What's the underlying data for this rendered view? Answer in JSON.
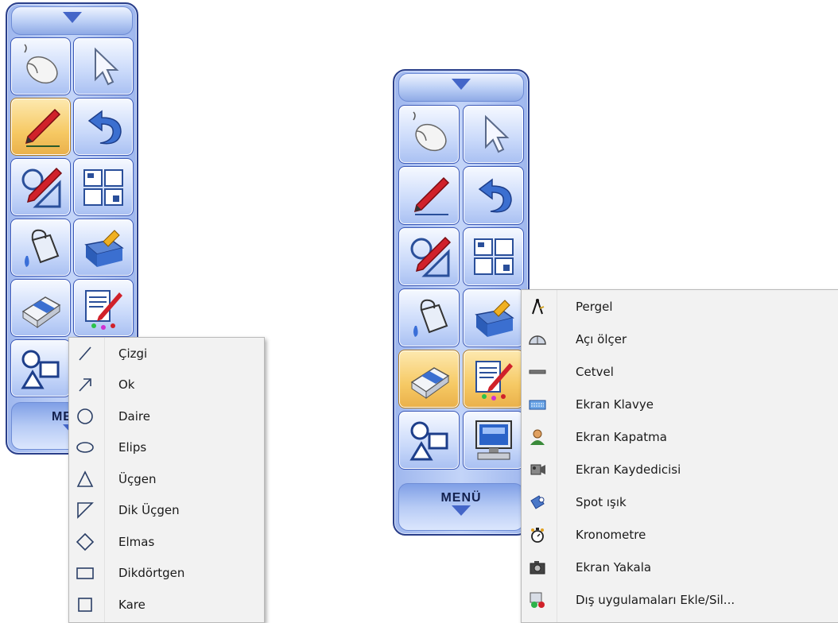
{
  "toolbar_left": {
    "menu_label": "MENÜ",
    "buttons": [
      {
        "name": "mouse-icon",
        "active": false
      },
      {
        "name": "arrow-pointer-icon",
        "active": false
      },
      {
        "name": "pen-icon",
        "active": true
      },
      {
        "name": "undo-icon",
        "active": false
      },
      {
        "name": "shapes-pen-icon",
        "active": false
      },
      {
        "name": "layout-pages-icon",
        "active": false
      },
      {
        "name": "paint-bucket-icon",
        "active": false
      },
      {
        "name": "toolbox-icon",
        "active": false
      },
      {
        "name": "eraser-icon",
        "active": false
      },
      {
        "name": "settings-tools-icon",
        "active": false
      },
      {
        "name": "shapes-icon",
        "active": false
      }
    ]
  },
  "shapes_menu": {
    "items": [
      {
        "label": "Çizgi",
        "icon": "line-icon"
      },
      {
        "label": "Ok",
        "icon": "arrow-icon"
      },
      {
        "label": "Daire",
        "icon": "circle-icon"
      },
      {
        "label": "Elips",
        "icon": "ellipse-icon"
      },
      {
        "label": "Üçgen",
        "icon": "triangle-icon"
      },
      {
        "label": "Dik Üçgen",
        "icon": "right-triangle-icon"
      },
      {
        "label": "Elmas",
        "icon": "diamond-icon"
      },
      {
        "label": "Dikdörtgen",
        "icon": "rectangle-icon"
      },
      {
        "label": "Kare",
        "icon": "square-icon"
      }
    ]
  },
  "toolbar_right": {
    "menu_label": "MENÜ",
    "buttons": [
      {
        "name": "mouse-icon",
        "active": false
      },
      {
        "name": "arrow-pointer-icon",
        "active": false
      },
      {
        "name": "pen-icon",
        "active": false
      },
      {
        "name": "undo-icon",
        "active": false
      },
      {
        "name": "shapes-pen-icon",
        "active": false
      },
      {
        "name": "layout-pages-icon",
        "active": false
      },
      {
        "name": "paint-bucket-icon",
        "active": false
      },
      {
        "name": "toolbox-icon",
        "active": false
      },
      {
        "name": "eraser-icon",
        "active": true
      },
      {
        "name": "settings-tools-icon",
        "active": true
      },
      {
        "name": "shapes-icon",
        "active": false
      },
      {
        "name": "computer-icon",
        "active": false
      }
    ]
  },
  "tools_menu": {
    "items": [
      {
        "label": "Pergel",
        "icon": "compass-icon"
      },
      {
        "label": "Açı ölçer",
        "icon": "protractor-icon"
      },
      {
        "label": "Cetvel",
        "icon": "ruler-icon"
      },
      {
        "label": "Ekran Klavye",
        "icon": "keyboard-icon"
      },
      {
        "label": "Ekran Kapatma",
        "icon": "screen-cover-icon"
      },
      {
        "label": "Ekran Kaydedicisi",
        "icon": "screen-recorder-icon"
      },
      {
        "label": "Spot ışık",
        "icon": "spotlight-icon"
      },
      {
        "label": "Kronometre",
        "icon": "stopwatch-icon"
      },
      {
        "label": "Ekran Yakala",
        "icon": "camera-icon"
      },
      {
        "label": "Dış uygulamaları Ekle/Sil...",
        "icon": "add-remove-apps-icon"
      }
    ]
  }
}
